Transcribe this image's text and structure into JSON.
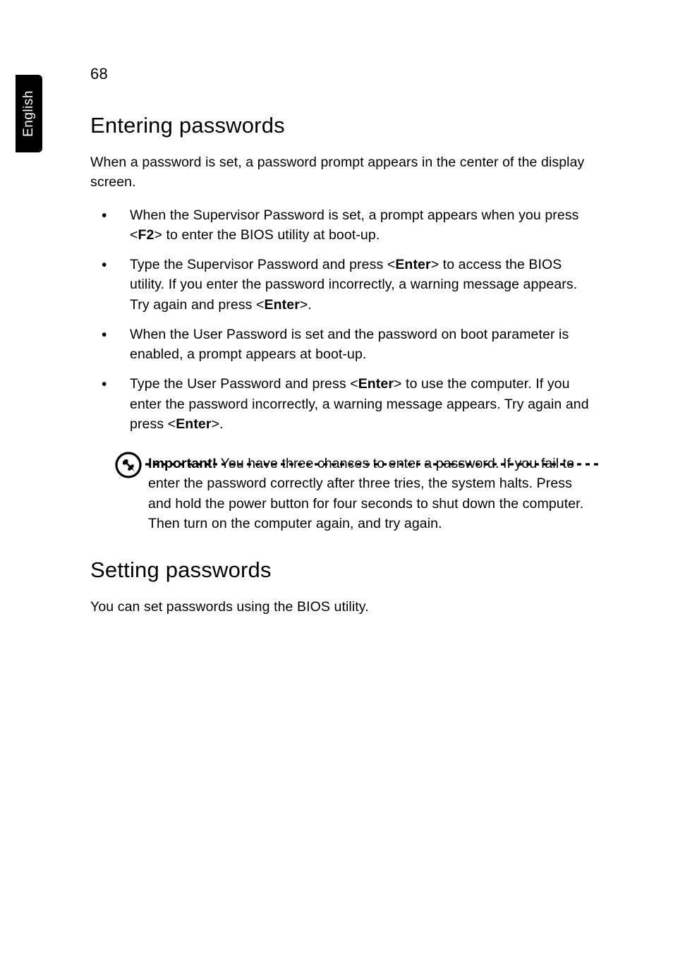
{
  "sideTab": {
    "language": "English"
  },
  "pageNumber": "68",
  "section1": {
    "heading": "Entering passwords",
    "intro": "When a password is set, a password prompt appears in the center of the display screen.",
    "bullets": {
      "b1": {
        "pre": "When the Supervisor Password is set, a prompt appears when you press <",
        "key": "F2",
        "post": "> to enter the BIOS utility at boot-up."
      },
      "b2": {
        "pre": "Type the Supervisor Password and press <",
        "key1": "Enter",
        "mid": "> to access the BIOS utility. If you enter the password incorrectly, a warning message appears. Try again and press <",
        "key2": "Enter",
        "post": ">."
      },
      "b3": {
        "text": "When the User Password is set and the password on boot parameter is enabled, a prompt appears at boot-up."
      },
      "b4": {
        "pre": "Type the User Password and press <",
        "key1": "Enter",
        "mid": "> to use the computer. If you enter the password incorrectly, a warning message appears. Try again and press <",
        "key2": "Enter",
        "post": ">."
      }
    },
    "note": {
      "label": "Important!",
      "text": " You have three chances to enter a password. If you fail to enter the password correctly after three tries, the system halts. Press and hold the power button for four seconds to shut down the computer. Then turn on the computer again, and try again."
    }
  },
  "section2": {
    "heading": "Setting passwords",
    "body": "You can set passwords using the BIOS utility."
  }
}
